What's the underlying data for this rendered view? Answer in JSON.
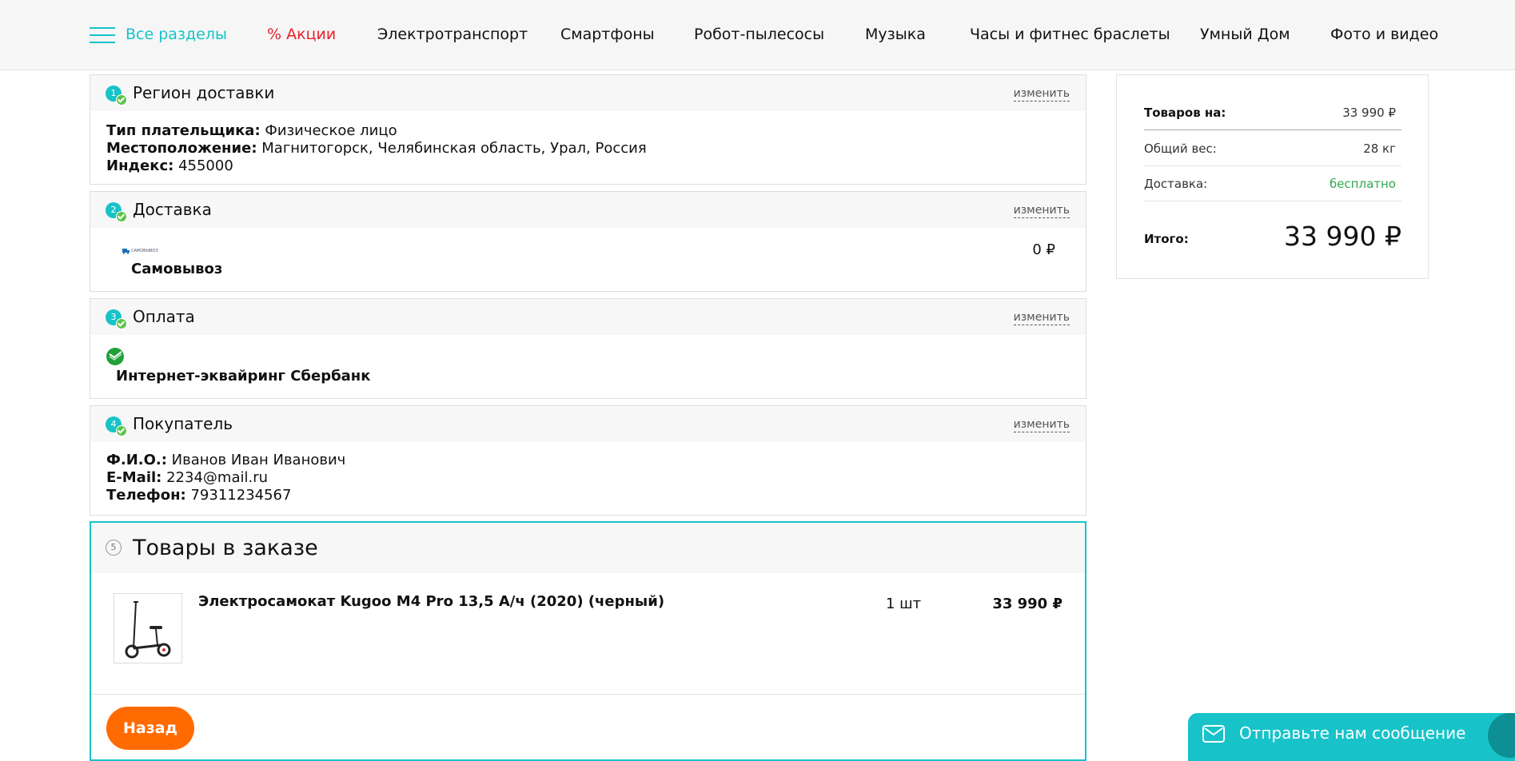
{
  "nav": {
    "all_sections": "Все разделы",
    "items": [
      "% Акции",
      "Электротранспорт",
      "Смартфоны",
      "Робот-пылесосы",
      "Музыка",
      "Часы и фитнес браслеты",
      "Умный Дом",
      "Фото и видео"
    ]
  },
  "edit_label": "изменить",
  "region": {
    "step": "1",
    "title": "Регион доставки",
    "payer_type_label": "Тип плательщика:",
    "payer_type_value": "Физическое лицо",
    "location_label": "Местоположение:",
    "location_value": "Магнитогорск, Челябинская область, Урал, Россия",
    "index_label": "Индекс:",
    "index_value": "455000"
  },
  "delivery": {
    "step": "2",
    "title": "Доставка",
    "method_logo_text": "САМОВЫВОЗ",
    "method": "Самовывоз",
    "price": "0 ₽"
  },
  "payment": {
    "step": "3",
    "title": "Оплата",
    "method": "Интернет-эквайринг Сбербанк"
  },
  "buyer": {
    "step": "4",
    "title": "Покупатель",
    "name_label": "Ф.И.О.:",
    "name_value": "Иванов Иван Иванович",
    "email_label": "E-Mail:",
    "email_value": "2234@mail.ru",
    "phone_label": "Телефон:",
    "phone_value": "79311234567"
  },
  "products": {
    "step": "5",
    "title": "Товары в заказе",
    "items": [
      {
        "name": "Электросамокат Kugoo M4 Pro 13,5 А/ч (2020) (черный)",
        "qty": "1 шт",
        "price": "33 990 ₽"
      }
    ],
    "back_label": "Назад"
  },
  "summary": {
    "goods_label": "Товаров на:",
    "goods_value": "33 990 ₽",
    "weight_label": "Общий вес:",
    "weight_value": "28 кг",
    "delivery_label": "Доставка:",
    "delivery_value": "бесплатно",
    "total_label": "Итого:",
    "total_value": "33 990 ₽"
  },
  "chat": {
    "label": "Отправьте нам сообщение"
  },
  "colors": {
    "accent": "#17c3c8",
    "sale": "#e8202a",
    "button": "#ff6b00",
    "free": "#2fa84f",
    "sber": "#21a038"
  }
}
